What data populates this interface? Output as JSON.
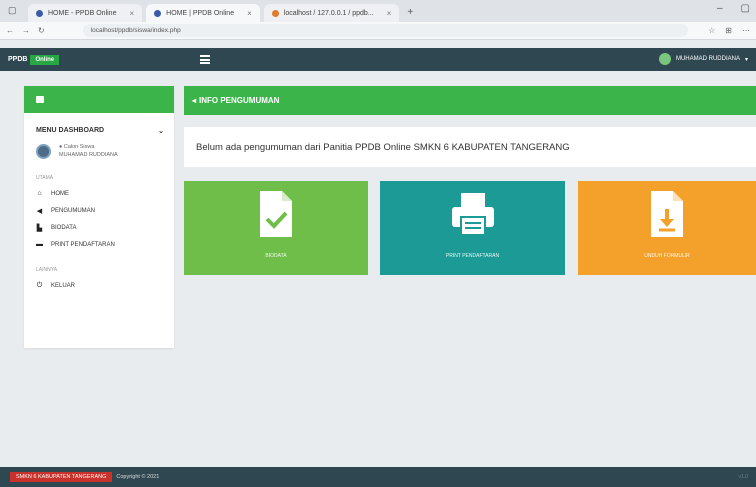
{
  "browser": {
    "tabs": [
      {
        "label": "HOME - PPDB Online"
      },
      {
        "label": "HOME | PPDB Online"
      },
      {
        "label": "localhost / 127.0.0.1 / ppdb..."
      }
    ],
    "address": "localhost/ppdb/siswa/index.php"
  },
  "topnav": {
    "brand": "PPDB",
    "brand_badge": "Online",
    "username": "MUHAMAD RUDDIANA"
  },
  "sidebar": {
    "menu_title": "MENU DASHBOARD",
    "user_role": "Calon Siswa",
    "user_name": "MUHAMAD RUDDIANA",
    "section_main": "UTAMA",
    "items": [
      {
        "label": "HOME"
      },
      {
        "label": "PENGUMUMAN"
      },
      {
        "label": "BIODATA"
      },
      {
        "label": "PRINT PENDAFTARAN"
      }
    ],
    "section_other": "LAINNYA",
    "logout": "KELUAR"
  },
  "content": {
    "header": "INFO PENGUMUMAN",
    "announcement": "Belum ada pengumuman dari Panitia PPDB Online SMKN 6 KABUPATEN TANGERANG",
    "cards": [
      {
        "label": "BIODATA",
        "color": "#6fbe4a"
      },
      {
        "label": "PRINT PENDAFTARAN",
        "color": "#1c9b96"
      },
      {
        "label": "UNDUH FORMULIR",
        "color": "#f4a12c"
      }
    ]
  },
  "footer": {
    "highlight": "SMKN 6 KABUPATEN TANGERANG",
    "copyright": "Copyright © 2021",
    "version": "v1.0"
  }
}
